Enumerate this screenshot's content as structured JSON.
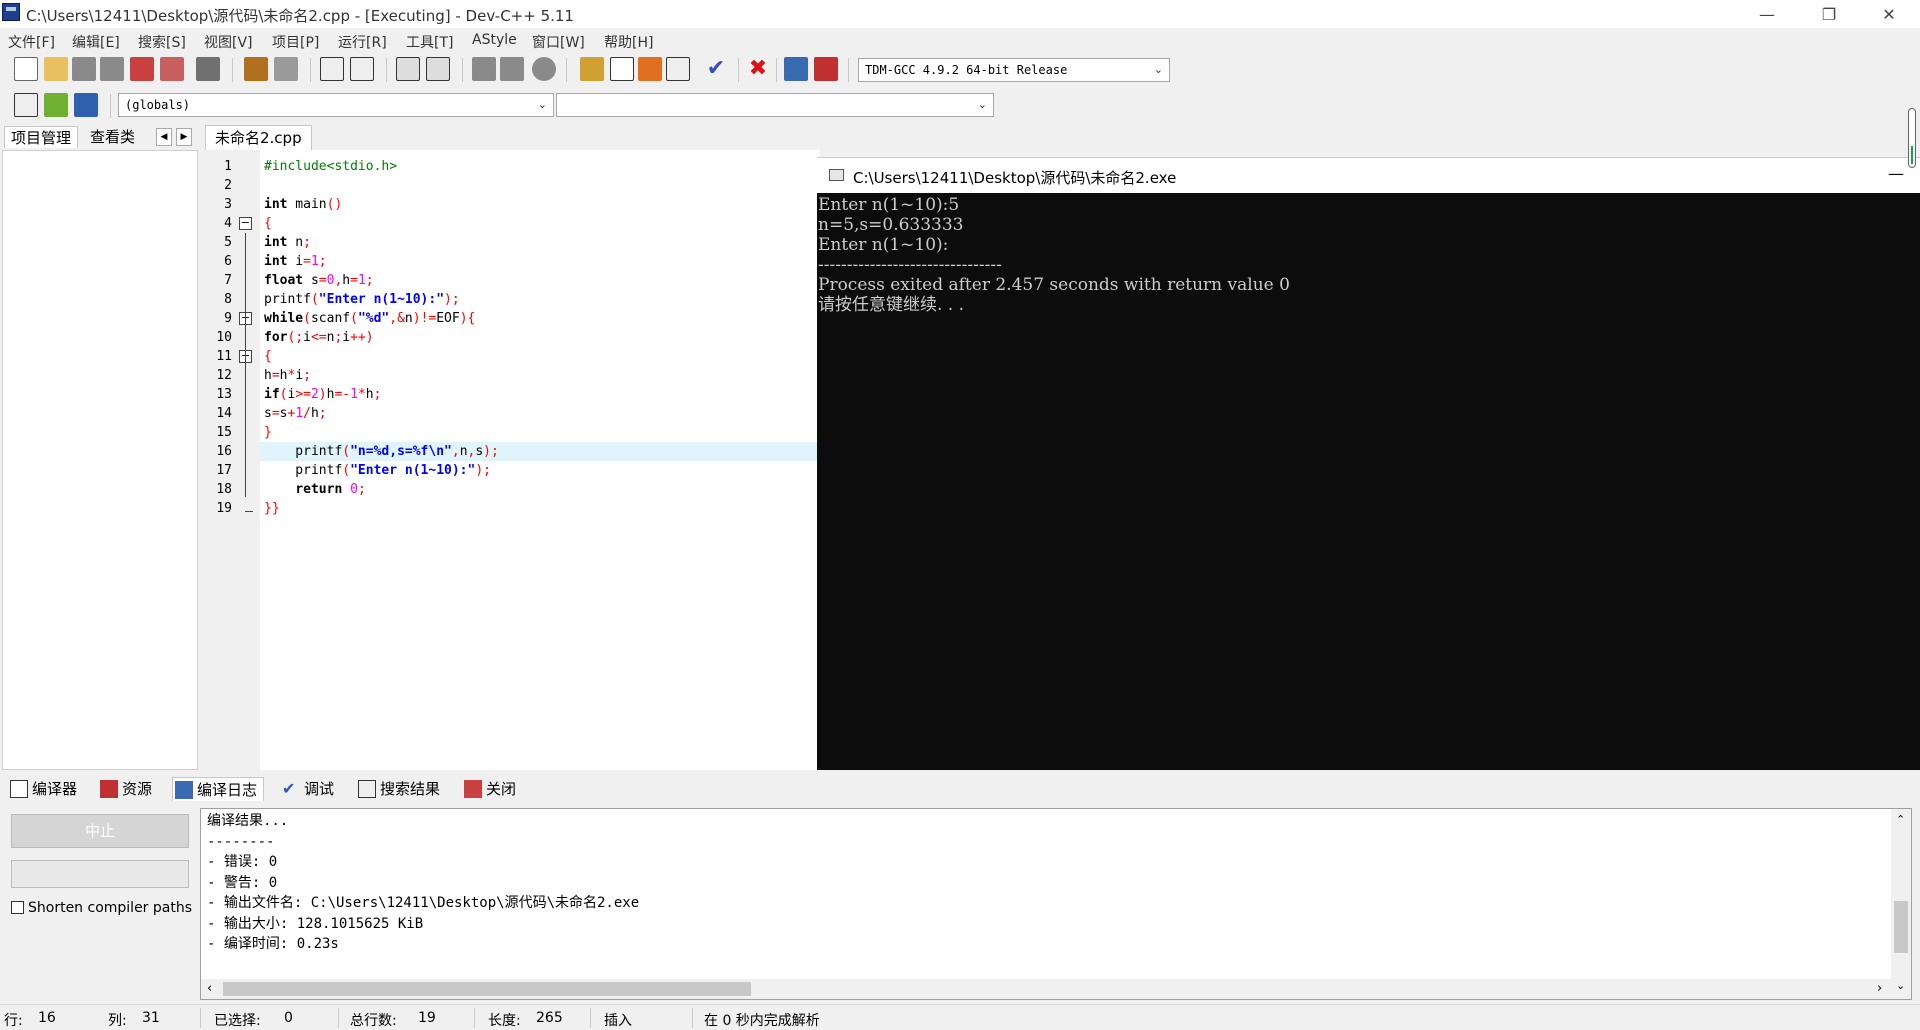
{
  "window": {
    "title": "C:\\Users\\12411\\Desktop\\源代码\\未命名2.cpp - [Executing] - Dev-C++ 5.11",
    "minimize": "—",
    "restore": "❐",
    "close": "✕"
  },
  "menu": [
    "文件[F]",
    "编辑[E]",
    "搜索[S]",
    "视图[V]",
    "项目[P]",
    "运行[R]",
    "工具[T]",
    "AStyle",
    "窗口[W]",
    "帮助[H]"
  ],
  "toolbar": {
    "compiler": "TDM-GCC 4.9.2 64-bit Release",
    "scope": "(globals)",
    "member": ""
  },
  "left_tabs": [
    "项目管理",
    "查看类"
  ],
  "editor": {
    "file_tab": "未命名2.cpp",
    "current_line": 16,
    "lines": [
      "#include<stdio.h>",
      "",
      "int main()",
      "{",
      "int n;",
      "int i=1;",
      "float s=0,h=1;",
      "printf(\"Enter n(1~10):\");",
      "while(scanf(\"%d\",&n)!=EOF){",
      "for(;i<=n;i++)",
      "{",
      "h=h*i;",
      "if(i>=2)h=-1*h;",
      "s=s+1/h;",
      "}",
      "    printf(\"n=%d,s=%f\\n\",n,s);",
      "    printf(\"Enter n(1~10):\");",
      "    return 0;",
      "}}"
    ]
  },
  "console": {
    "title": "C:\\Users\\12411\\Desktop\\源代码\\未命名2.exe",
    "minimize": "—",
    "lines": [
      "Enter n(1~10):5",
      "n=5,s=0.633333",
      "Enter n(1~10):",
      "--------------------------------",
      "Process exited after 2.457 seconds with return value 0",
      "请按任意键继续. . ."
    ]
  },
  "bottom_tabs": [
    "编译器",
    "资源",
    "编译日志",
    "调试",
    "搜索结果",
    "关闭"
  ],
  "bottom_left": {
    "stop_label": "中止",
    "checkbox_label": "Shorten compiler paths"
  },
  "log_lines": [
    "编译结果...",
    "--------",
    "- 错误: 0",
    "- 警告: 0",
    "- 输出文件名: C:\\Users\\12411\\Desktop\\源代码\\未命名2.exe",
    "- 输出大小: 128.1015625 KiB",
    "- 编译时间: 0.23s"
  ],
  "status": {
    "row_label": "行:",
    "row": "16",
    "col_label": "列:",
    "col": "31",
    "sel_label": "已选择:",
    "sel": "0",
    "total_label": "总行数:",
    "total": "19",
    "len_label": "长度:",
    "len": "265",
    "mode": "插入",
    "parse": "在 0 秒内完成解析"
  }
}
